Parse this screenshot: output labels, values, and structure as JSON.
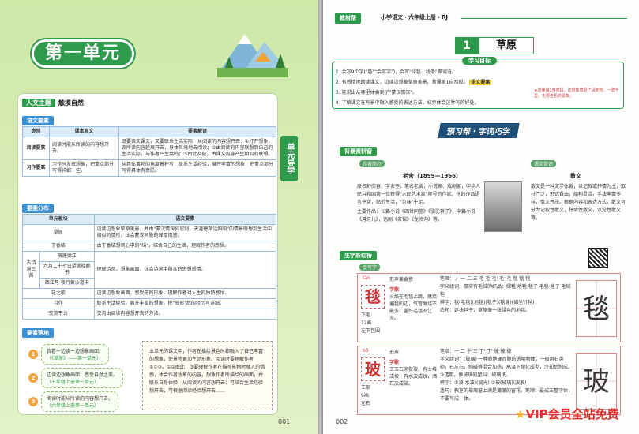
{
  "left": {
    "unit_title": "第一单元",
    "theme_tag": "人文主题",
    "theme_value": "触摸自然",
    "side_tab": "单元导学",
    "req_head": "语文要素",
    "req_table": {
      "headers": [
        "类别",
        "课本原文",
        "要素解读"
      ],
      "rows": [
        [
          "阅读要素",
          "阅读时能从所读的内容想开去。",
          "既要去文课文，又要联系生活实际，从阅读的内容想开去：①打开想象，调所读内容延展开去，身体其境地去阅读；②由阅读的内容联想到自己的生活实际，与作者产生共鸣；③由此及彼，由课文内容产生相似的联想。"
        ],
        [
          "习作要素",
          "习作时发挥想象，把重点部分写得详细一些。",
          "从具体事物的角度着补写，联系生活经验，展开丰富的想象，把重点部分写得具体有意愿。"
        ]
      ]
    },
    "dist_head": "要素分布",
    "dist_table": {
      "headers": [
        "单元板块",
        "语文要素"
      ],
      "rows": [
        {
          "name": "草原",
          "sub": "",
          "text": "边读边想象草原美景，并由\"蒙汉情深何忍别，天涯碧草话斜阳\"的情景联想到生活中相似的情形，体会蒙汉同胞的深厚情感。"
        },
        {
          "name": "丁香结",
          "sub": "",
          "text": "由丁香结想到心中的\"结\"，结合自己的生活，理解作者的感悟。"
        },
        {
          "name": "古诗词三首",
          "sub": "宿建德江",
          "text": "理解诗意，想象画面，体会诗词中蕴含的思想感情。"
        },
        {
          "name": "",
          "sub": "六月二十七日望湖楼醉书",
          "text": ""
        },
        {
          "name": "",
          "sub": "西江月·夜行黄沙道中",
          "text": ""
        },
        {
          "name": "花之歌",
          "sub": "",
          "text": "边读边想象画面，感受花的形象，理解作者对人生的独特感悟。"
        },
        {
          "name": "习作",
          "sub": "",
          "text": "联系生活经验，展开丰富的想象，把\"变形\"后的经历写详细。"
        },
        {
          "name": "交流平台",
          "sub": "",
          "text": "交流由阅读内容想开去的方法。"
        }
      ]
    },
    "steps_head": "要素落地",
    "steps": [
      {
        "num": "1",
        "text": "我看一边读一边想象画面。",
        "sub": "（《草原》——第一单元）"
      },
      {
        "num": "2",
        "text": "边读边想象画面，感受自然之美。",
        "sub": "（五年级上册第一单元）"
      },
      {
        "num": "3",
        "text": "阅读时能从所读的内容想开去。",
        "sub": "（六年级上册第一单元）"
      }
    ],
    "note": "本单元的课文中，作者在描绘景色时都融入了自己丰富的想象，使景物更加生动形象。阅读时要理解作者①①②。①②由此，③要理解作者在描写景物时融入的情感，体会作者想象的内容，想象作者所描绘的画面，并联系自身体验，从阅读的内容想开去：可结合生活经验想开去，可根据阅读经验想开去……",
    "page_no": "001"
  },
  "right": {
    "header_logo": "教材帮",
    "header_title": "小学语文・六年级上册・RJ",
    "lesson_num": "1",
    "lesson_title": "草原",
    "obj_head": "学习目标",
    "objectives": [
      "1. 会写9个字(\"毡\"\"会写字\")，会写\"绿毯、线条\"等词语。",
      "2. 有感情地朗读课文，边读边想象草原美景。背诵第1自然段。",
      "3. 能说出从哪里体会到了\"蒙汉情深\"。",
      "4. 了解课文在写景中融入感受的表达方法，初步体会这种写的好处。"
    ],
    "obj_highlight": "语文要素",
    "obj_note": "★边读第1自然段，边想象草原广阔天地，一碧千里，无限生机的景象。",
    "prep_title": "预习帮・字词巧学",
    "bg_head": "背景资料窗",
    "author_tag": "作者简介",
    "author_name": "老舍（1899—1966）",
    "author_text": "原名舒庆春，字舍予，笔名老舍，小说家、戏剧家，中华人民共和国第一位获得\"人民艺术家\"称号的作家。他的作品语言平实，贴近生活，\"京味\"十足。",
    "author_works": "主要作品：长篇小说《四世同堂》《骆驼祥子》，中篇小说《月牙儿》，话剧《茶馆》《龙须沟》等。",
    "prose_tag": "语文常识",
    "prose_title": "散文",
    "prose_text": "散文是一种文学体裁，以记叙或抒情为主，取材广泛，形式自由，结构灵活，手法丰富多样，情文并茂。根据内容和表达方式，散文可分为记叙性散文，抒情性散文，议论性散文等。",
    "char_head": "生字彩虹桥",
    "char_tag": "会写字",
    "chars": [
      {
        "pinyin": "tǎn",
        "char": "毯",
        "structure": "下毛",
        "strokes": "12画",
        "type": "左下包围",
        "hdr": "形声兼会意",
        "poem_title": "字歌",
        "poem": "火焰在毛毯上跳，燃烧遍毯的边，气管发烧不能多，盖好毛毯不让火。",
        "bihua": "笔顺：丿 一 二 三 毛 毛 毛' 毛' 毛 毯 毯 毯",
        "zuci": "字义组词：厚实有毛绒的织品：绿毯 地毯 毯子 毛毯 毯子 毛绒毡",
        "bianxi": "辨字：毯(毛毯)(地毯)(毯子)(毯身)(如坐针毡)",
        "zaoju": "造句：这块毯子，草原像一张绿色的地毯。"
      },
      {
        "pinyin": "bō",
        "char": "玻",
        "structure": "王部",
        "strokes": "9画",
        "type": "左右",
        "hdr": "形声",
        "poem_title": "字歌",
        "poem": "王玉石来做玻，有土堆成坡，有水波成纹，洒石皮成破。",
        "bihua": "笔顺：一 二 千 王 丁' 丁' 玻 玻 玻",
        "zuci": "字义组词：[玻璃] 一种质地硬而脆的透明物体，一般用石英砂，石灰石，纯碱等混合加热，高温下熔化成型，冷却后制成。②透明，像玻璃的塑料：玻璃纸。",
        "bianxi": "辨字：①波(水波)(波光) ②玻(玻璃)(波浪)",
        "zaoju": "造句：教室的玻璃窗上满是蒲蒲的窗花。笔顺：最成玉整字体，不要写成一体。"
      }
    ],
    "page_no": "002",
    "vip": "VIP会员全站免费"
  }
}
